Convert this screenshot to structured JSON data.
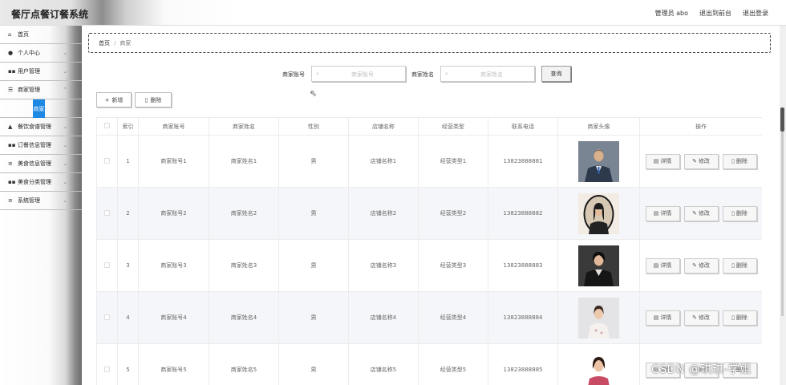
{
  "app": {
    "title": "餐厅点餐订餐系统"
  },
  "header": {
    "user": "管理员 abo",
    "back_front": "退出到前台",
    "logout": "退出登录"
  },
  "sidebar": {
    "items": [
      {
        "label": "首页",
        "icon": "home-icon",
        "has_chevron": false
      },
      {
        "label": "个人中心",
        "icon": "user-icon",
        "has_chevron": true
      },
      {
        "label": "用户管理",
        "icon": "grid-icon",
        "has_chevron": true
      },
      {
        "label": "商家管理",
        "icon": "sliders-icon",
        "has_chevron": true
      },
      {
        "label": "餐饮食谱管理",
        "icon": "thumbs-up-icon",
        "has_chevron": true
      },
      {
        "label": "订餐信息管理",
        "icon": "grid-icon",
        "has_chevron": true
      },
      {
        "label": "美食信息管理",
        "icon": "list-icon",
        "has_chevron": true
      },
      {
        "label": "美食分类管理",
        "icon": "grid-icon",
        "has_chevron": true
      },
      {
        "label": "系统管理",
        "icon": "list-icon",
        "has_chevron": true
      }
    ],
    "active_sub": "商家"
  },
  "breadcrumb": {
    "home": "首页",
    "sep": "/",
    "current": "商家"
  },
  "search": {
    "label1": "商家账号",
    "placeholder1": "商家账号",
    "label2": "商家姓名",
    "placeholder2": "商家姓名",
    "button": "查询"
  },
  "actions": {
    "add": "新增",
    "delete": "删除"
  },
  "table": {
    "headers": [
      "",
      "索引",
      "商家账号",
      "商家姓名",
      "性别",
      "店铺名称",
      "经营类型",
      "联系电话",
      "商家头像",
      "操作"
    ],
    "rows": [
      {
        "index": "1",
        "account": "商家账号1",
        "name": "商家姓名1",
        "gender": "男",
        "shop": "店铺名称1",
        "type": "经营类型1",
        "phone": "13823888881"
      },
      {
        "index": "2",
        "account": "商家账号2",
        "name": "商家姓名2",
        "gender": "男",
        "shop": "店铺名称2",
        "type": "经营类型2",
        "phone": "13823888882"
      },
      {
        "index": "3",
        "account": "商家账号3",
        "name": "商家姓名3",
        "gender": "男",
        "shop": "店铺名称3",
        "type": "经营类型3",
        "phone": "13823888883"
      },
      {
        "index": "4",
        "account": "商家账号4",
        "name": "商家姓名4",
        "gender": "男",
        "shop": "店铺名称4",
        "type": "经营类型4",
        "phone": "13823888884"
      },
      {
        "index": "5",
        "account": "商家账号5",
        "name": "商家姓名5",
        "gender": "男",
        "shop": "店铺名称5",
        "type": "经营类型5",
        "phone": "13823888885"
      }
    ],
    "ops": {
      "detail": "详情",
      "edit": "修改",
      "delete": "删除"
    }
  },
  "watermark": "CSDN @琪琪-学姐"
}
